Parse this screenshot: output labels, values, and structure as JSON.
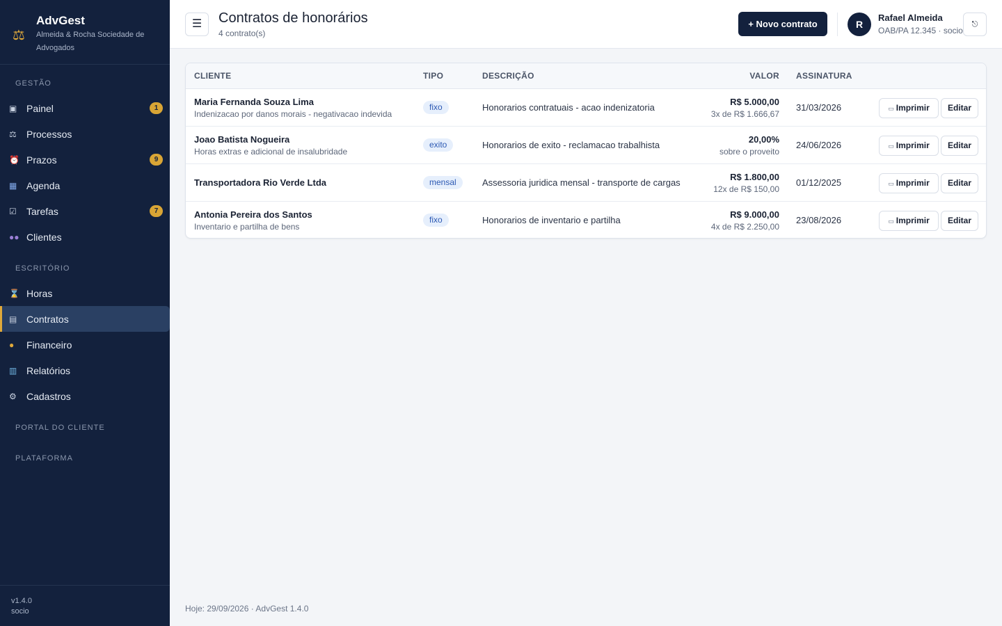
{
  "brand": {
    "title": "AdvGest",
    "subtitle": "Almeida & Rocha Sociedade de Advogados",
    "logo_icon": "scales-icon"
  },
  "sidebar": {
    "sections": [
      {
        "label": "GESTÃO"
      },
      {
        "label": "ESCRITÓRIO"
      },
      {
        "label": "PORTAL DO CLIENTE"
      },
      {
        "label": "PLATAFORMA"
      }
    ],
    "items": [
      {
        "label": "Painel",
        "icon": "dashboard-icon",
        "badge": "1"
      },
      {
        "label": "Processos",
        "icon": "processes-icon"
      },
      {
        "label": "Prazos",
        "icon": "alarm-clock-icon",
        "badge": "9"
      },
      {
        "label": "Agenda",
        "icon": "calendar-icon"
      },
      {
        "label": "Tarefas",
        "icon": "checkbox-icon",
        "badge": "7"
      },
      {
        "label": "Clientes",
        "icon": "people-icon"
      },
      {
        "label": "Horas",
        "icon": "hourglass-icon"
      },
      {
        "label": "Contratos",
        "icon": "document-icon",
        "active": true
      },
      {
        "label": "Financeiro",
        "icon": "money-bag-icon"
      },
      {
        "label": "Relatórios",
        "icon": "bar-chart-icon"
      },
      {
        "label": "Cadastros",
        "icon": "gear-icon"
      }
    ],
    "footer": {
      "version": "v1.4.0",
      "role": "socio"
    }
  },
  "header": {
    "title": "Contratos de honorários",
    "subtitle": "4 contrato(s)",
    "new_button": "+ Novo contrato",
    "user": {
      "initial": "R",
      "name": "Rafael Almeida",
      "role": "OAB/PA 12.345 · socio"
    }
  },
  "table": {
    "columns": [
      "CLIENTE",
      "TIPO",
      "DESCRIÇÃO",
      "VALOR",
      "ASSINATURA"
    ],
    "print_label": "Imprimir",
    "edit_label": "Editar",
    "rows": [
      {
        "client": "Maria Fernanda Souza Lima",
        "process": "Indenizacao por danos morais - negativacao indevida",
        "type": "fixo",
        "description": "Honorarios contratuais - acao indenizatoria",
        "value": "R$ 5.000,00",
        "value_sub": "3x de R$ 1.666,67",
        "date": "31/03/2026"
      },
      {
        "client": "Joao Batista Nogueira",
        "process": "Horas extras e adicional de insalubridade",
        "type": "exito",
        "description": "Honorarios de exito - reclamacao trabalhista",
        "value": "20,00%",
        "value_sub": "sobre o proveito",
        "date": "24/06/2026"
      },
      {
        "client": "Transportadora Rio Verde Ltda",
        "process": "",
        "type": "mensal",
        "description": "Assessoria juridica mensal - transporte de cargas",
        "value": "R$ 1.800,00",
        "value_sub": "12x de R$ 150,00",
        "date": "01/12/2025"
      },
      {
        "client": "Antonia Pereira dos Santos",
        "process": "Inventario e partilha de bens",
        "type": "fixo",
        "description": "Honorarios de inventario e partilha",
        "value": "R$ 9.000,00",
        "value_sub": "4x de R$ 2.250,00",
        "date": "23/08/2026"
      }
    ]
  },
  "footer_note": "Hoje: 29/09/2026 · AdvGest 1.4.0"
}
